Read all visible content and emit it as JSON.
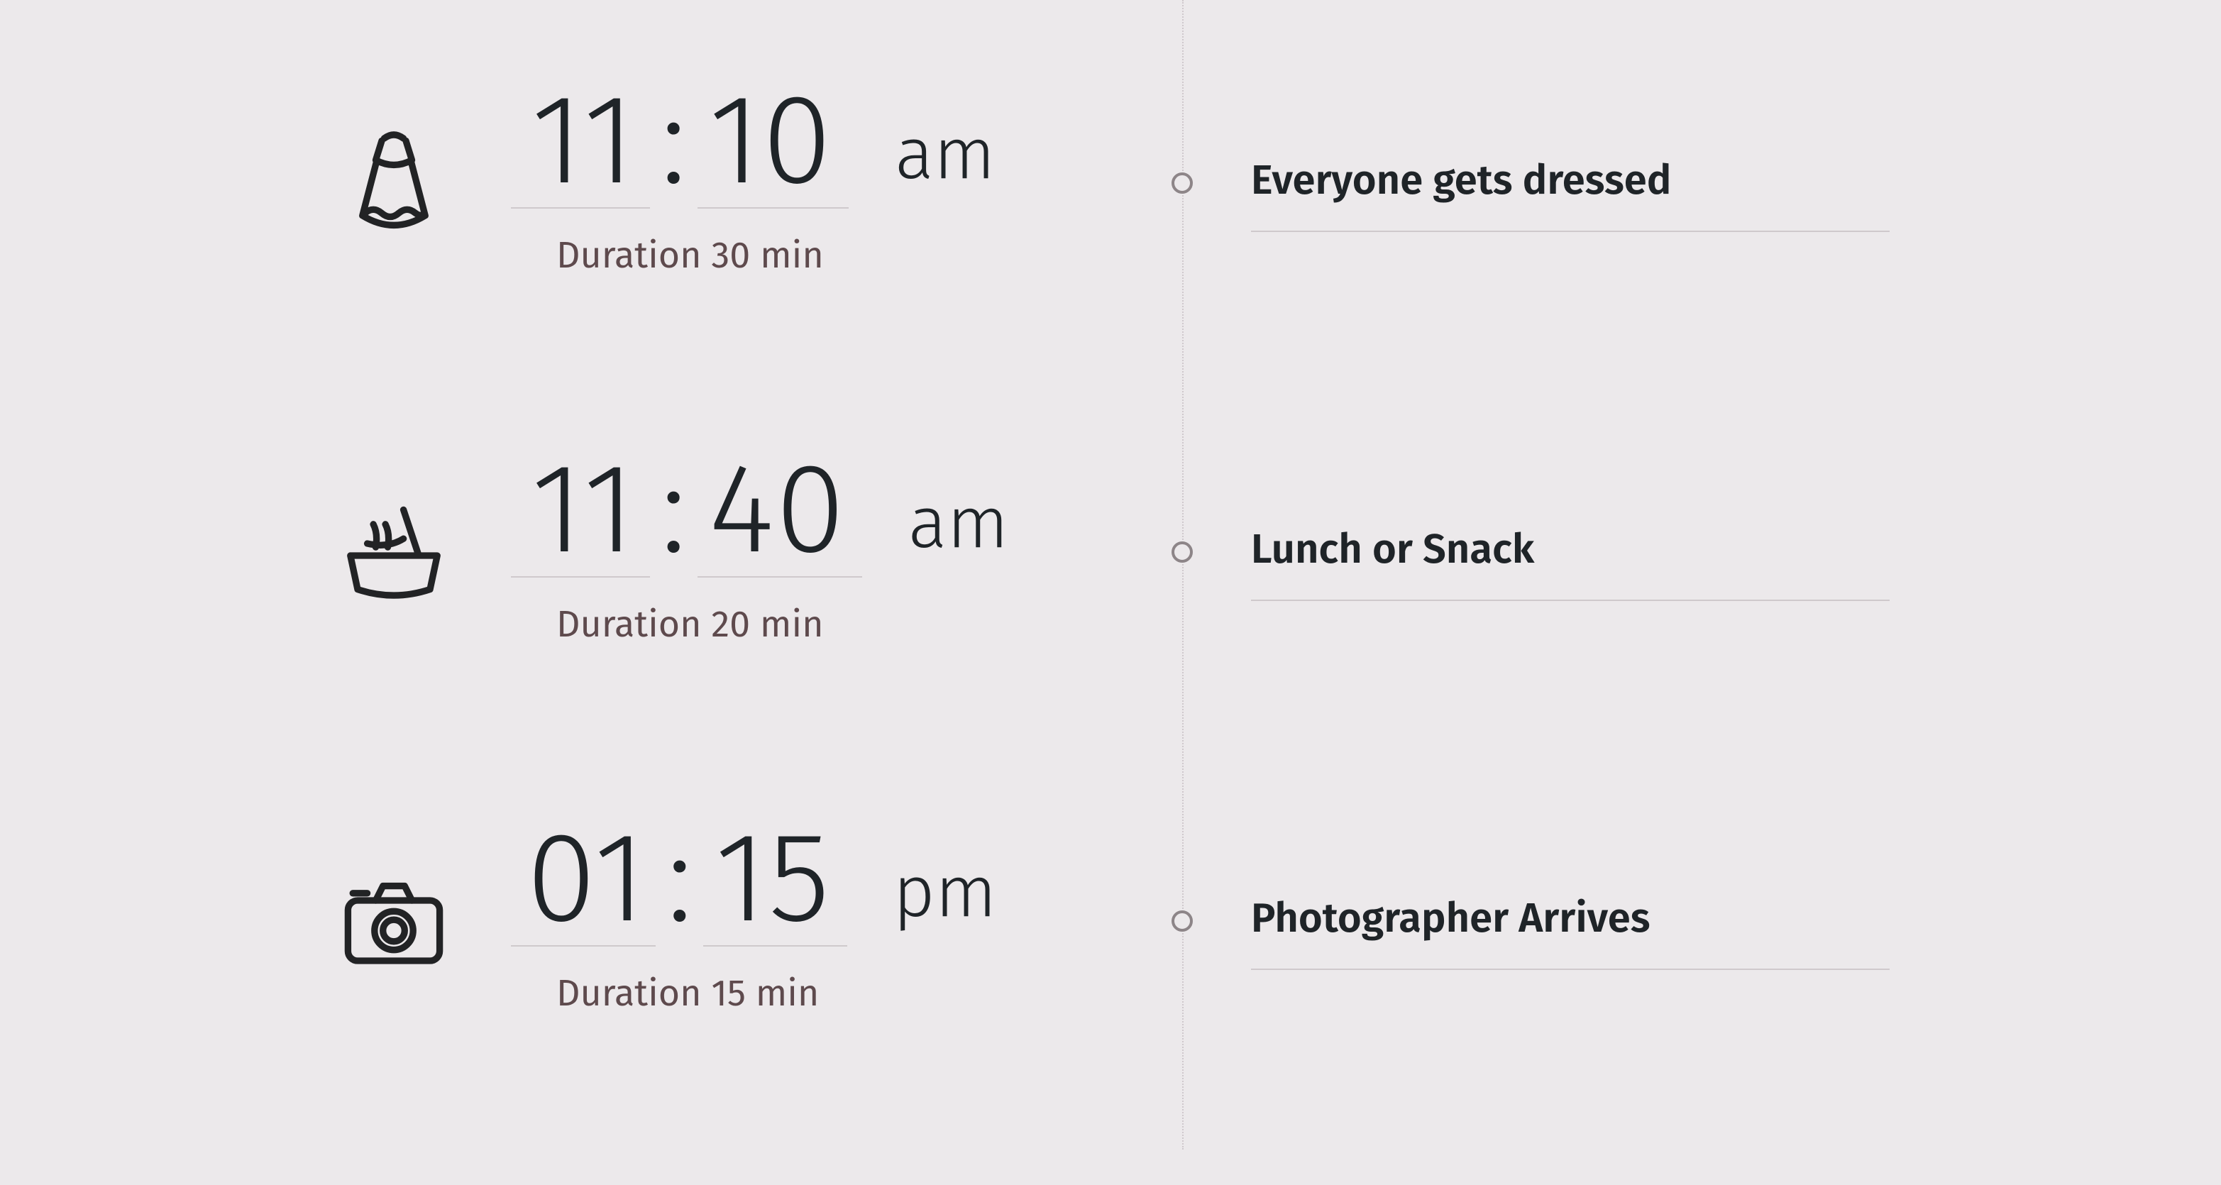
{
  "timeline": {
    "events": [
      {
        "icon": "dress-icon",
        "hour": "11",
        "minute": "10",
        "ampm": "am",
        "duration_label": "Duration 30 min",
        "title": "Everyone gets dressed"
      },
      {
        "icon": "food-bowl-icon",
        "hour": "11",
        "minute": "40",
        "ampm": "am",
        "duration_label": "Duration 20 min",
        "title": "Lunch or Snack"
      },
      {
        "icon": "camera-icon",
        "hour": "01",
        "minute": "15",
        "ampm": "pm",
        "duration_label": "Duration 15 min",
        "title": "Photographer Arrives"
      }
    ]
  }
}
